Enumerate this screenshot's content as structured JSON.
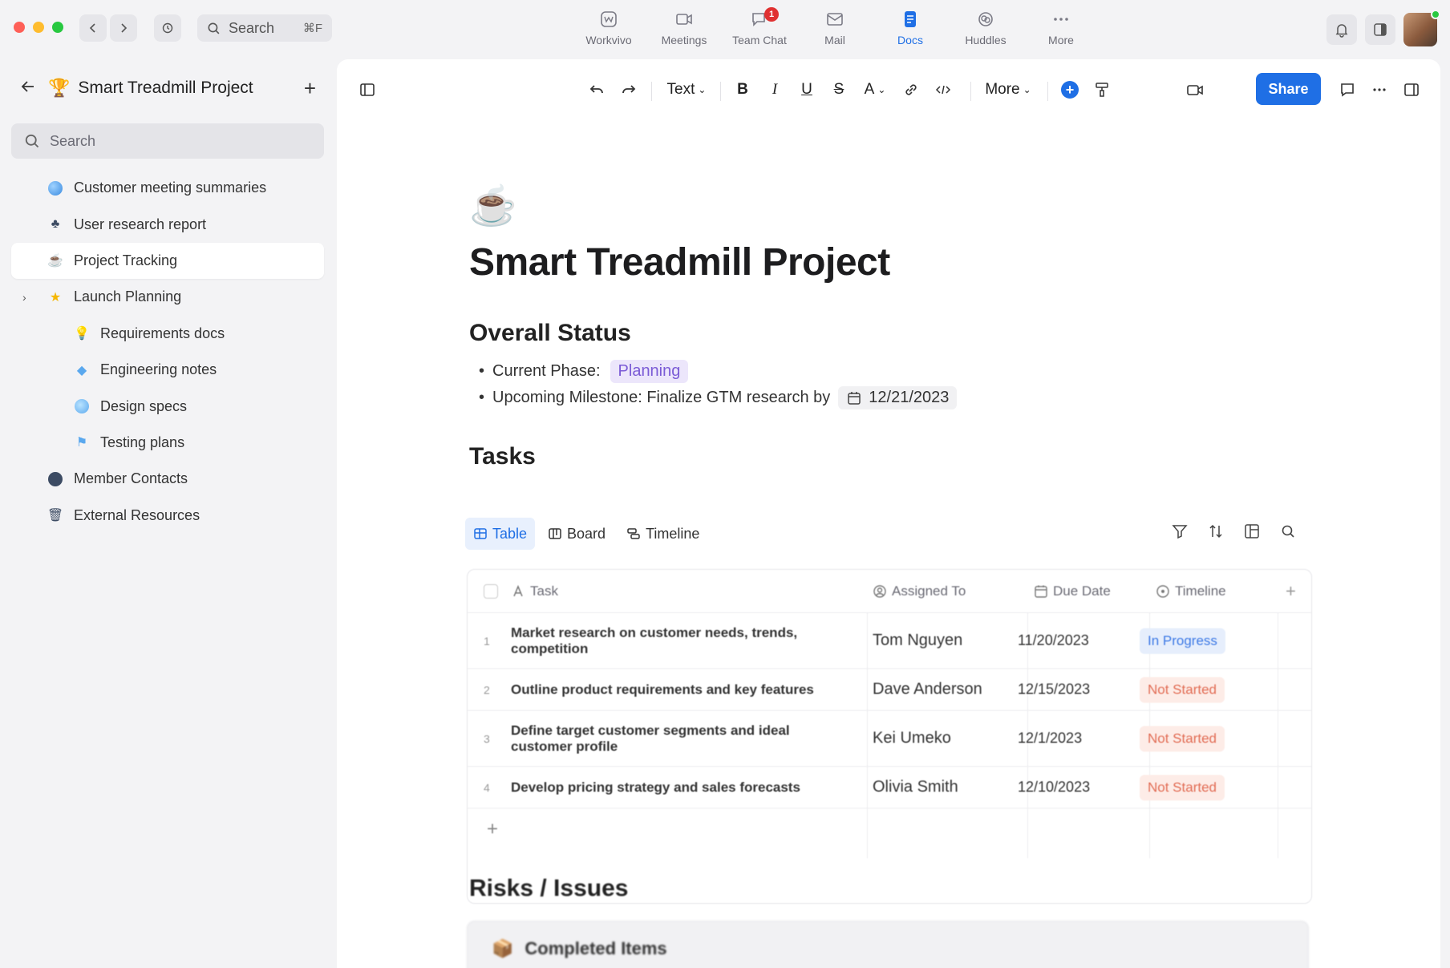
{
  "top_search": {
    "placeholder": "Search",
    "shortcut": "⌘F"
  },
  "app_nav": [
    {
      "label": "Workvivo",
      "icon": "workvivo-icon"
    },
    {
      "label": "Meetings",
      "icon": "video-icon"
    },
    {
      "label": "Team Chat",
      "icon": "chat-icon",
      "badge": "1"
    },
    {
      "label": "Mail",
      "icon": "mail-icon"
    },
    {
      "label": "Docs",
      "icon": "docs-icon",
      "active": true
    },
    {
      "label": "Huddles",
      "icon": "huddles-icon"
    },
    {
      "label": "More",
      "icon": "more-icon"
    }
  ],
  "sidebar": {
    "title": "Smart Treadmill Project",
    "search_placeholder": "Search",
    "items": [
      {
        "label": "Customer meeting summaries",
        "icon": "globe-icon",
        "level": 0
      },
      {
        "label": "User research report",
        "icon": "club-icon",
        "level": 0
      },
      {
        "label": "Project Tracking",
        "icon": "cup-icon",
        "level": 0,
        "active": true
      },
      {
        "label": "Launch Planning",
        "icon": "star-icon",
        "level": 0,
        "expandable": true
      },
      {
        "label": "Requirements docs",
        "icon": "lightbulb-icon",
        "level": 1
      },
      {
        "label": "Engineering notes",
        "icon": "diamond-icon",
        "level": 1
      },
      {
        "label": "Design specs",
        "icon": "palette-icon",
        "level": 1
      },
      {
        "label": "Testing plans",
        "icon": "sign-icon",
        "level": 1
      },
      {
        "label": "Member Contacts",
        "icon": "speech-icon",
        "level": 0
      },
      {
        "label": "External Resources",
        "icon": "trash-icon",
        "level": 0
      }
    ]
  },
  "toolbar": {
    "text_style": "Text",
    "more_label": "More",
    "share_label": "Share"
  },
  "doc": {
    "title": "Smart Treadmill Project",
    "overall_status_heading": "Overall Status",
    "current_phase_label": "Current Phase:",
    "current_phase_value": "Planning",
    "milestone_label": "Upcoming Milestone: Finalize GTM research by",
    "milestone_date": "12/21/2023",
    "tasks_heading": "Tasks",
    "views": [
      "Table",
      "Board",
      "Timeline"
    ],
    "risks_heading": "Risks / Issues",
    "completed_items": "Completed Items"
  },
  "table": {
    "columns": [
      "Task",
      "Assigned To",
      "Due Date",
      "Timeline"
    ],
    "rows": [
      {
        "num": "1",
        "task": "Market research on customer needs, trends, competition",
        "assigned": "Tom Nguyen",
        "due": "11/20/2023",
        "status": "In Progress"
      },
      {
        "num": "2",
        "task": "Outline product requirements and key features",
        "assigned": "Dave Anderson",
        "due": "12/15/2023",
        "status": "Not Started"
      },
      {
        "num": "3",
        "task": "Define target customer segments and ideal customer profile",
        "assigned": "Kei Umeko",
        "due": "12/1/2023",
        "status": "Not Started"
      },
      {
        "num": "4",
        "task": "Develop pricing strategy and sales forecasts",
        "assigned": "Olivia Smith",
        "due": "12/10/2023",
        "status": "Not Started"
      }
    ]
  },
  "colors": {
    "accent": "#1f6fe5",
    "in_progress": "#3f7be6",
    "not_started": "#e26d55",
    "planning": "#7b5bd6"
  }
}
